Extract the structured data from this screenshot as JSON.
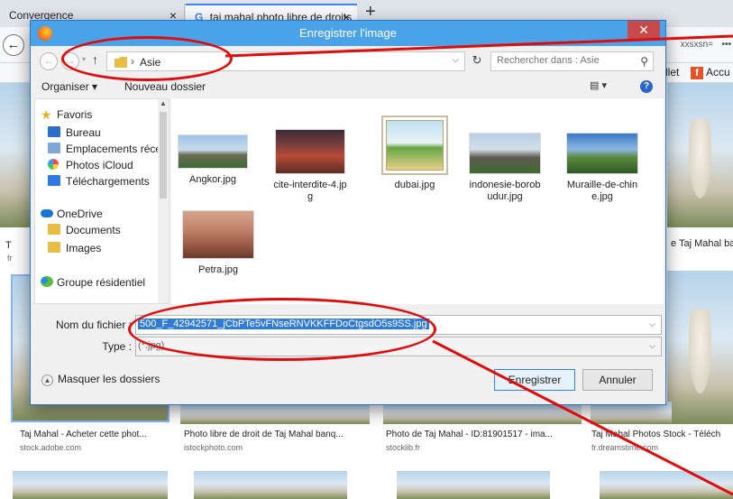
{
  "browser": {
    "tabs": [
      {
        "label": "Convergence",
        "close": "×"
      },
      {
        "label": "taj mahal photo libre de droits",
        "close": "×"
      }
    ],
    "new_tab": "+",
    "back": "←",
    "url_fragment": "xxsxsn=",
    "url_more": "•••",
    "bookmarks": [
      {
        "label": "llet"
      },
      {
        "label": "Accu"
      }
    ],
    "results": {
      "row1_side_left_caption": "T",
      "row1_side_left_src": "fr",
      "row1_right_caption": "e Taj Mahal ba",
      "row2": [
        {
          "caption": "Taj Mahal - Acheter cette phot...",
          "source": "stock.adobe.com"
        },
        {
          "caption": "Photo libre de droit de Taj Mahal banq...",
          "source": "istockphoto.com"
        },
        {
          "caption": "Photo de Taj Mahal - ID:81901517 - ima...",
          "source": "stocklib.fr"
        },
        {
          "caption": "Taj Mahal Photos Stock - Téléch",
          "source": "fr.dreamstime.com"
        }
      ]
    }
  },
  "dialog": {
    "title": "Enregistrer l'image",
    "close": "✕",
    "breadcrumb": {
      "separator": "›",
      "folder": "Asie"
    },
    "search_placeholder": "Rechercher dans : Asie",
    "toolbar": {
      "organize": "Organiser ▾",
      "new_folder": "Nouveau dossier"
    },
    "nav": {
      "favorites": "Favoris",
      "items": [
        "Bureau",
        "Emplacements réce",
        "Photos iCloud",
        "Téléchargements"
      ],
      "onedrive": "OneDrive",
      "onedrive_items": [
        "Documents",
        "Images"
      ],
      "homegroup": "Groupe résidentiel"
    },
    "files": [
      {
        "name": "Angkor.jpg"
      },
      {
        "name": "cite-interdite-4.jpg"
      },
      {
        "name": "dubai.jpg"
      },
      {
        "name": "indonesie-borobudur.jpg"
      },
      {
        "name": "Muraille-de-chine.jpg"
      },
      {
        "name": "Petra.jpg"
      }
    ],
    "filename_label": "Nom du fichier :",
    "filename_value": "500_F_42942571_jCbPTe5vFNseRNVKKFFDoCtgsdO5s9SS.jpg",
    "type_label": "Type :",
    "type_value": "(*.jpg)",
    "hide_folders": "Masquer les dossiers",
    "save_button": "Enregistrer",
    "cancel_button": "Annuler"
  },
  "colors": {
    "title_bar": "#4aa2e8",
    "selection": "#2f7bd6",
    "annotation": "#e00b0b"
  }
}
